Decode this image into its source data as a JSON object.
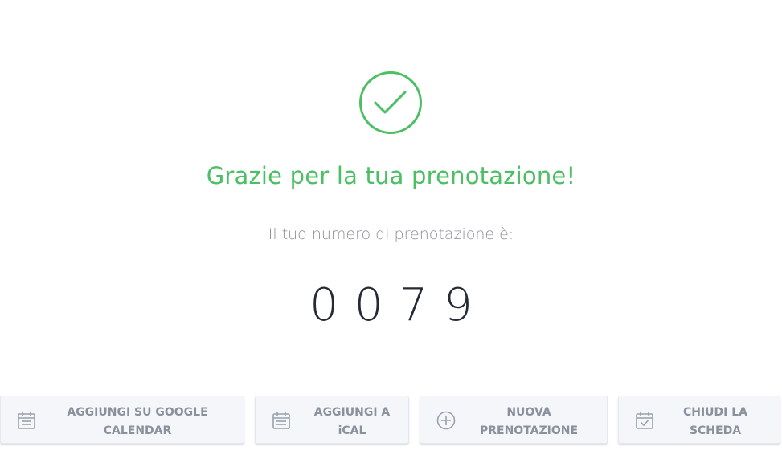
{
  "confirmation": {
    "title": "Grazie per la tua prenotazione!",
    "subtitle": "Il tuo numero di prenotazione è:",
    "booking_number": "0079",
    "icon": "check-circle-icon",
    "accent_color": "#4bbf63"
  },
  "actions": {
    "google_calendar": {
      "label": "AGGIUNGI SU GOOGLE\nCALENDAR",
      "icon": "calendar-icon"
    },
    "ical": {
      "label": "AGGIUNGI A\niCAL",
      "icon": "calendar-icon"
    },
    "new_booking": {
      "label": "NUOVA\nPRENOTAZIONE",
      "icon": "plus-circle-icon"
    },
    "close_tab": {
      "label": "CHIUDI LA\nSCHEDA",
      "icon": "calendar-check-icon"
    }
  }
}
